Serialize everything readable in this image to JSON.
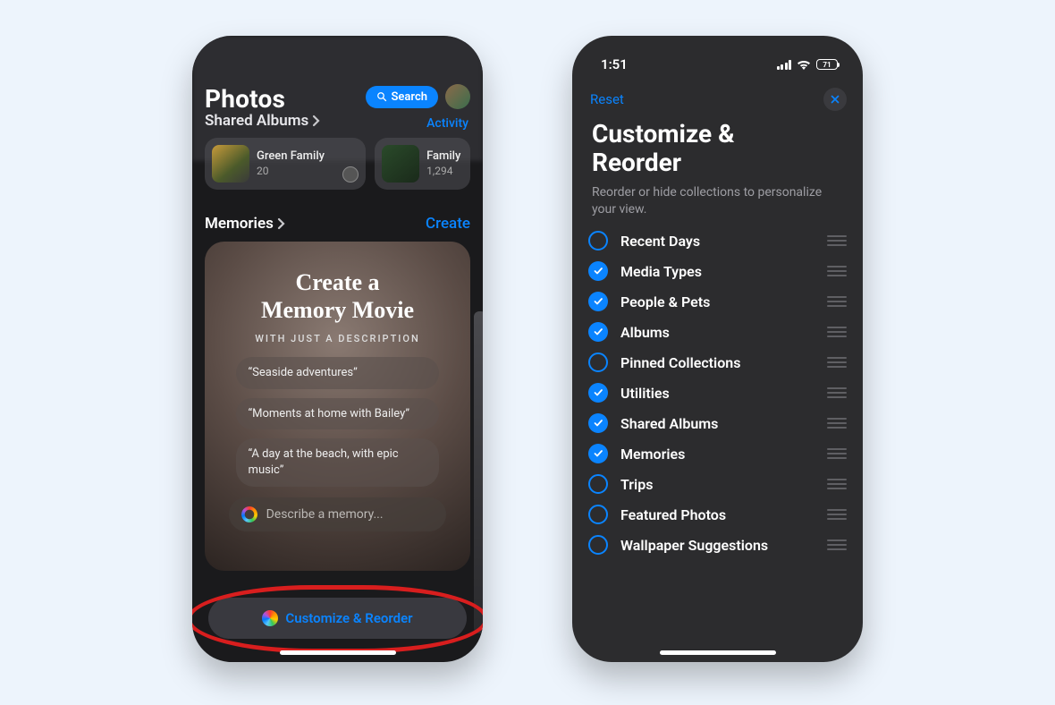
{
  "status": {
    "time": "1:51",
    "battery": "71"
  },
  "left": {
    "title": "Photos",
    "subtitle": "Shared Albums",
    "search_label": "Search",
    "activity_label": "Activity",
    "albums": [
      {
        "name": "Green Family",
        "count": "20"
      },
      {
        "name": "Family",
        "count": "1,294"
      }
    ],
    "memories_label": "Memories",
    "create_label": "Create",
    "memory": {
      "title_line1": "Create a",
      "title_line2": "Memory Movie",
      "subtitle": "WITH JUST A DESCRIPTION",
      "prompts": [
        "“Seaside adventures”",
        "“Moments at home with Bailey”",
        "“A day at the beach, with epic music”"
      ],
      "describe_placeholder": "Describe a memory..."
    },
    "customize_button": "Customize & Reorder"
  },
  "right": {
    "reset_label": "Reset",
    "title": "Customize & Reorder",
    "subtitle": "Reorder or hide collections to personalize your view.",
    "items": [
      {
        "label": "Recent Days",
        "checked": false
      },
      {
        "label": "Media Types",
        "checked": true
      },
      {
        "label": "People & Pets",
        "checked": true
      },
      {
        "label": "Albums",
        "checked": true
      },
      {
        "label": "Pinned Collections",
        "checked": false
      },
      {
        "label": "Utilities",
        "checked": true
      },
      {
        "label": "Shared Albums",
        "checked": true
      },
      {
        "label": "Memories",
        "checked": true
      },
      {
        "label": "Trips",
        "checked": false
      },
      {
        "label": "Featured Photos",
        "checked": false
      },
      {
        "label": "Wallpaper Suggestions",
        "checked": false
      }
    ]
  }
}
